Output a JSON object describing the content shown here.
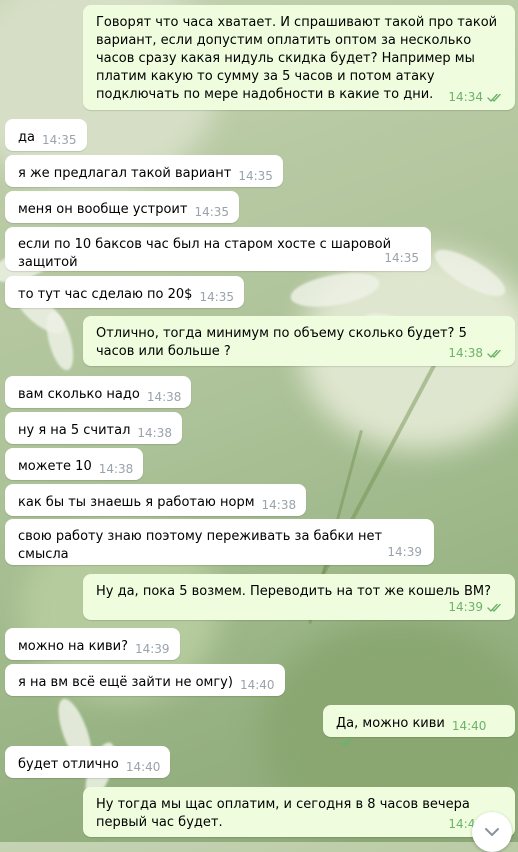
{
  "colors": {
    "incoming_bubble": "#ffffff",
    "outgoing_bubble": "#effdde",
    "time_out": "#6cb26a",
    "time_in": "#9aa3ab"
  },
  "messages": [
    {
      "dir": "out",
      "text": "Говорят что часа хватает. И спрашивают такой про такой вариант, если допустим оплатить оптом за несколько часов сразу какая нидуль скидка будет? Например мы платим какую то сумму за 5 часов и потом атаку подключать по мере надобности в какие то дни.",
      "time": "14:34",
      "read": true
    },
    {
      "dir": "in",
      "text": "да",
      "time": "14:35"
    },
    {
      "dir": "in",
      "text": "я же предлагал такой вариант",
      "time": "14:35"
    },
    {
      "dir": "in",
      "text": "меня он вообще устроит",
      "time": "14:35"
    },
    {
      "dir": "in",
      "text": "если по 10 баксов час был на старом хосте с шаровой защитой",
      "time": "14:35"
    },
    {
      "dir": "in",
      "text": "то тут час сделаю по 20$",
      "time": "14:35"
    },
    {
      "dir": "out",
      "text": "Отлично, тогда минимум по объему сколько будет? 5 часов или больше ?",
      "time": "14:38",
      "read": true
    },
    {
      "dir": "in",
      "text": "вам сколько надо",
      "time": "14:38"
    },
    {
      "dir": "in",
      "text": "ну я на 5 считал",
      "time": "14:38"
    },
    {
      "dir": "in",
      "text": "можете 10",
      "time": "14:38"
    },
    {
      "dir": "in",
      "text": "как бы ты знаешь я работаю норм",
      "time": "14:38"
    },
    {
      "dir": "in",
      "text": "свою работу знаю поэтому переживать за бабки нет смысла",
      "time": "14:39"
    },
    {
      "dir": "out",
      "text": "Ну да, пока 5 возмем. Переводить на тот же кошель ВМ?",
      "time": "14:39",
      "read": true
    },
    {
      "dir": "in",
      "text": "можно на киви?",
      "time": "14:39"
    },
    {
      "dir": "in",
      "text": "я на вм всё ещё зайти не омгу)",
      "time": "14:40"
    },
    {
      "dir": "out",
      "text": "Да, можно киви",
      "time": "14:40",
      "read": true
    },
    {
      "dir": "in",
      "text": "будет отлично",
      "time": "14:40"
    },
    {
      "dir": "out",
      "text": "Ну тогда мы щас оплатим, и сегодня в 8 часов вечера первый час будет.",
      "time": "14:41",
      "read": true
    }
  ],
  "scroll_button": {
    "icon": "chevron-down-icon"
  }
}
